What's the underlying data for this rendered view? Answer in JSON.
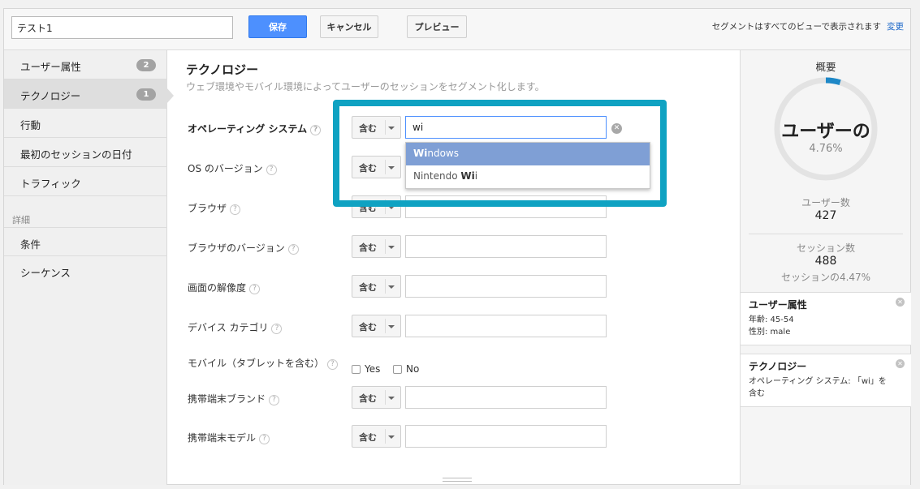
{
  "toolbar": {
    "segment_name": "テスト1",
    "save_label": "保存",
    "cancel_label": "キャンセル",
    "preview_label": "プレビュー",
    "note": "セグメントはすべてのビューで表示されます",
    "change_label": "変更"
  },
  "sidebar": {
    "items": [
      {
        "label": "ユーザー属性",
        "badge": "2"
      },
      {
        "label": "テクノロジー",
        "badge": "1"
      },
      {
        "label": "行動"
      },
      {
        "label": "最初のセッションの日付"
      },
      {
        "label": "トラフィック"
      }
    ],
    "section_label": "詳細",
    "advanced_items": [
      {
        "label": "条件"
      },
      {
        "label": "シーケンス"
      }
    ]
  },
  "main": {
    "title": "テクノロジー",
    "subtitle": "ウェブ環境やモバイル環境によってユーザーのセッションをセグメント化します。",
    "help_glyph": "?",
    "operator_label": "含む",
    "rows": [
      {
        "label": "オペレーティング システム",
        "value": "wi"
      },
      {
        "label": "OS のバージョン",
        "value": ""
      },
      {
        "label": "ブラウザ",
        "value": ""
      },
      {
        "label": "ブラウザのバージョン",
        "value": ""
      },
      {
        "label": "画面の解像度",
        "value": ""
      },
      {
        "label": "デバイス カテゴリ",
        "value": ""
      }
    ],
    "mobile": {
      "label": "モバイル（タブレットを含む）",
      "yes": "Yes",
      "no": "No"
    },
    "rows2": [
      {
        "label": "携帯端末ブランド",
        "value": ""
      },
      {
        "label": "携帯端末モデル",
        "value": ""
      }
    ],
    "suggestions": [
      {
        "match": "Wi",
        "rest": "ndows",
        "prefix": ""
      },
      {
        "prefix": "Nintendo ",
        "match": "Wi",
        "rest": "i"
      }
    ]
  },
  "summary": {
    "title": "概要",
    "donut_label": "ユーザーの",
    "donut_percent": "4.76%",
    "donut_fraction": 0.0476,
    "users_label": "ユーザー数",
    "users_value": "427",
    "sessions_label": "セッション数",
    "sessions_value": "488",
    "sessions_pct": "セッションの4.47%",
    "cards": [
      {
        "title": "ユーザー属性",
        "lines": [
          "年齢: 45-54",
          "性別: male"
        ]
      },
      {
        "title": "テクノロジー",
        "lines": [
          "オペレーティング システム: 「wi」を",
          "含む"
        ]
      }
    ]
  },
  "colors": {
    "accent": "#4d90fe",
    "highlight": "#0fa2c2",
    "donut_fill": "#1e88c7",
    "dropdown_selected": "#7f9fd5"
  }
}
